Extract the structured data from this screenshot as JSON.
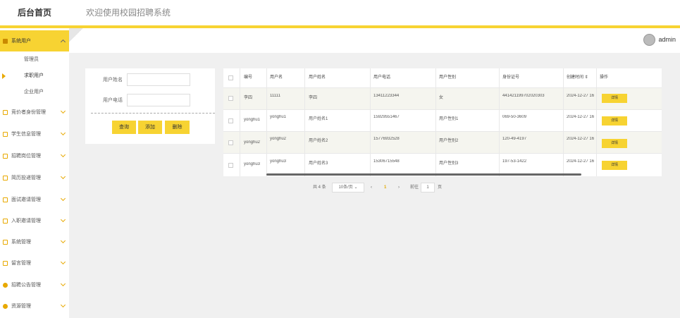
{
  "header": {
    "brand": "后台首页",
    "welcome": "欢迎使用校园招聘系统"
  },
  "user": {
    "name": "admin"
  },
  "sidebar": {
    "active_group": {
      "label": "系统用户",
      "icon": "user-icon"
    },
    "sub_items": [
      "管理员",
      "求职用户",
      "企业用户"
    ],
    "selected_sub": "求职用户",
    "groups": [
      {
        "label": "竞价者身份管理",
        "icon": "folder-icon"
      },
      {
        "label": "学生信息管理",
        "icon": "folder-icon"
      },
      {
        "label": "招聘岗位管理",
        "icon": "folder-icon"
      },
      {
        "label": "简历投递管理",
        "icon": "folder-icon"
      },
      {
        "label": "面试邀请管理",
        "icon": "folder-icon"
      },
      {
        "label": "入职邀请管理",
        "icon": "folder-icon"
      },
      {
        "label": "系统管理",
        "icon": "folder-icon"
      },
      {
        "label": "留言管理",
        "icon": "folder-icon"
      },
      {
        "label": "招聘公告管理",
        "icon": "info-icon"
      },
      {
        "label": "资源管理",
        "icon": "pin-icon"
      }
    ]
  },
  "search": {
    "fields": [
      {
        "label": "用户姓名",
        "value": ""
      },
      {
        "label": "用户电话",
        "value": ""
      }
    ],
    "buttons": {
      "query": "查询",
      "add": "添加",
      "delete": "删除"
    }
  },
  "table": {
    "columns": [
      "",
      "编号",
      "用户名",
      "用户姓名",
      "用户电话",
      "用户性别",
      "身份证号",
      "创建时间 ⇕",
      "操作"
    ],
    "rows": [
      {
        "id": "李四",
        "username": "11111",
        "name": "李四",
        "phone": "13411223344",
        "gender": "女",
        "idcard": "441421199702020303",
        "created": "2024-12-27 16",
        "action": "详情"
      },
      {
        "id": "yonghu1",
        "username": "yonghu1",
        "name": "用户姓名1",
        "phone": "15929551467",
        "gender": "用户性别1",
        "idcard": "069-50-3609",
        "created": "2024-12-27 16",
        "action": "详情"
      },
      {
        "id": "yonghu2",
        "username": "yonghu2",
        "name": "用户姓名2",
        "phone": "15776932528",
        "gender": "用户性别2",
        "idcard": "120-49-4197",
        "created": "2024-12-27 16",
        "action": "详情"
      },
      {
        "id": "yonghu3",
        "username": "yonghu3",
        "name": "用户姓名3",
        "phone": "15306715548",
        "gender": "用户性别3",
        "idcard": "197-53-1422",
        "created": "2024-12-27 16",
        "action": "详情"
      }
    ]
  },
  "pagination": {
    "total": "共 4 条",
    "page_size": "10条/页",
    "prev": "‹",
    "current_page": "1",
    "next": "›",
    "goto_label": "前往",
    "goto_value": "1",
    "page_suffix": "页"
  },
  "colors": {
    "accent": "#f7d332",
    "background": "#f0f0f0"
  }
}
